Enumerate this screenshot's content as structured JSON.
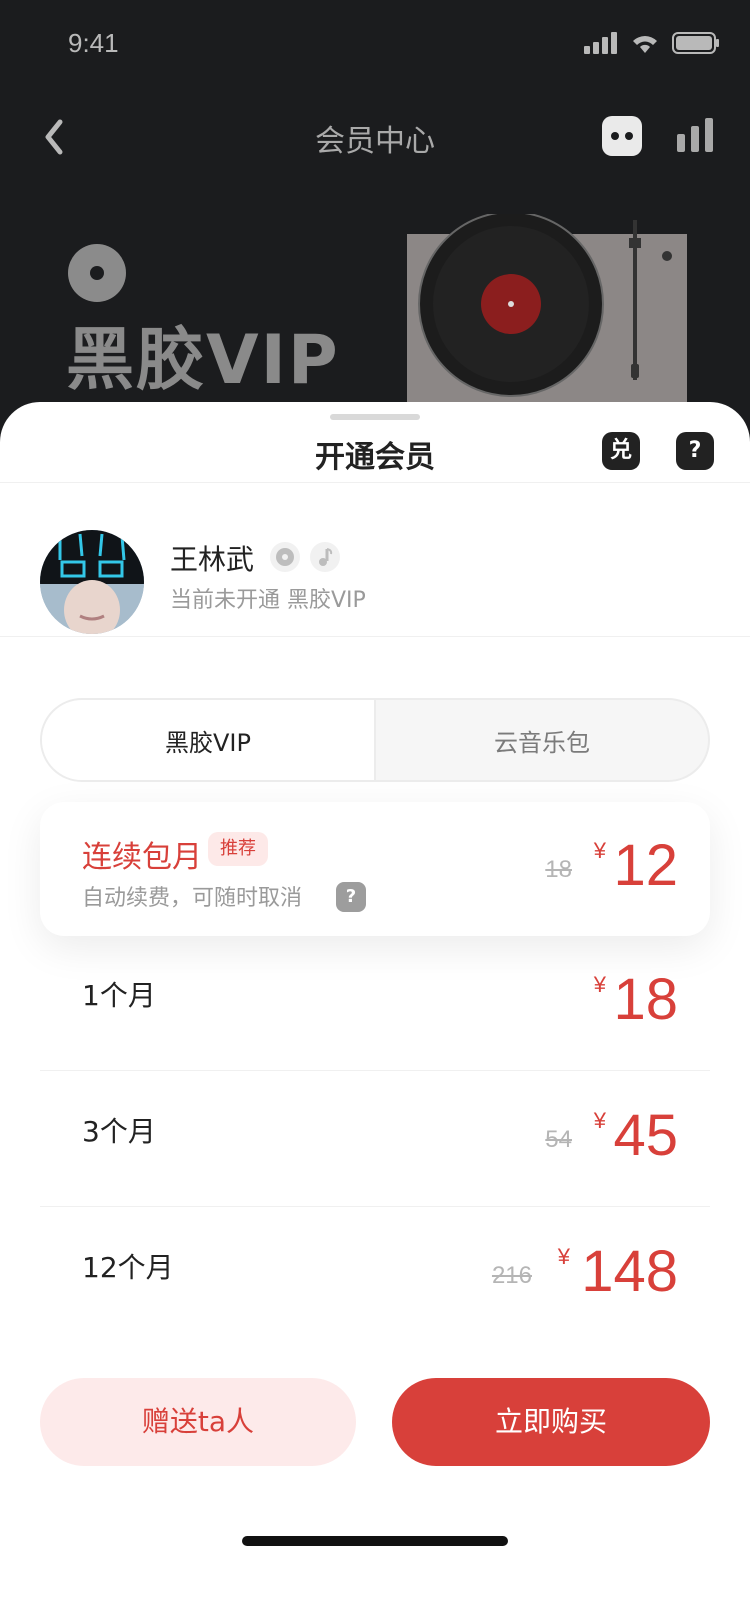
{
  "status": {
    "time": "9:41"
  },
  "nav": {
    "title": "会员中心"
  },
  "hero": {
    "title": "黑胶VIP"
  },
  "sheet": {
    "title": "开通会员",
    "redeem_icon_label": "兑",
    "help_icon_label": "?"
  },
  "user": {
    "name": "王林武",
    "status": "当前未开通 黑胶VIP"
  },
  "tabs": [
    {
      "label": "黑胶VIP",
      "active": true
    },
    {
      "label": "云音乐包",
      "active": false
    }
  ],
  "plans": [
    {
      "name": "连续包月",
      "badge": "推荐",
      "desc": "自动续费，可随时取消",
      "help": "?",
      "old_price": "18",
      "currency": "¥",
      "price": "12"
    },
    {
      "name": "1个月",
      "old_price": "",
      "currency": "¥",
      "price": "18"
    },
    {
      "name": "3个月",
      "old_price": "54",
      "currency": "¥",
      "price": "45"
    },
    {
      "name": "12个月",
      "old_price": "216",
      "currency": "¥",
      "price": "148"
    }
  ],
  "buttons": {
    "gift": "赠送ta人",
    "buy": "立即购买"
  },
  "colors": {
    "accent": "#d8403a",
    "dark_bg": "#1b1c1e",
    "gift_bg": "#fdeaea"
  },
  "icons": [
    "back-arrow-icon",
    "robot-icon",
    "chart-icon",
    "vinyl-badge-icon",
    "redeem-icon",
    "help-icon",
    "vinyl-badge-small-icon",
    "music-note-icon",
    "question-icon"
  ]
}
